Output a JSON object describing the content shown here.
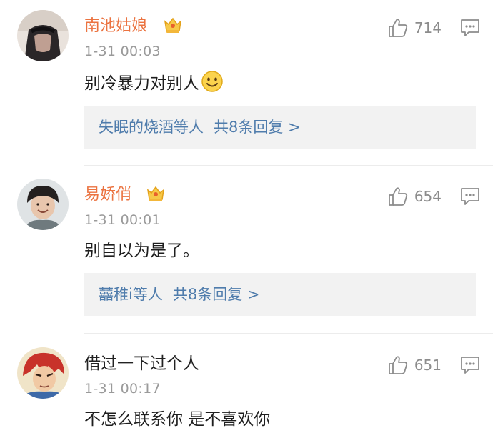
{
  "comments": [
    {
      "username": "南池姑娘",
      "time": "1-31 00:03",
      "text": "别冷暴力对别人",
      "likes": "714",
      "replies": {
        "users": "失眠的烧酒等人",
        "count_label": "共8条回复 >"
      }
    },
    {
      "username": "易娇俏",
      "time": "1-31 00:01",
      "text": "别自以为是了。",
      "likes": "654",
      "replies": {
        "users": "囍稚i等人",
        "count_label": "共8条回复 >"
      }
    },
    {
      "username": "借过一下过个人",
      "time": "1-31 00:17",
      "text": "不怎么联系你 是不喜欢你",
      "likes": "651"
    }
  ],
  "icons": {
    "like": "thumbs-up-icon",
    "reply": "comment-icon",
    "badge": "crown-badge-icon",
    "emoji": "smile-emoji"
  },
  "colors": {
    "username_vip": "#eb7340",
    "reply_link": "#4f7cac",
    "meta": "#9a9a9a",
    "reply_bg": "#f2f2f2"
  }
}
